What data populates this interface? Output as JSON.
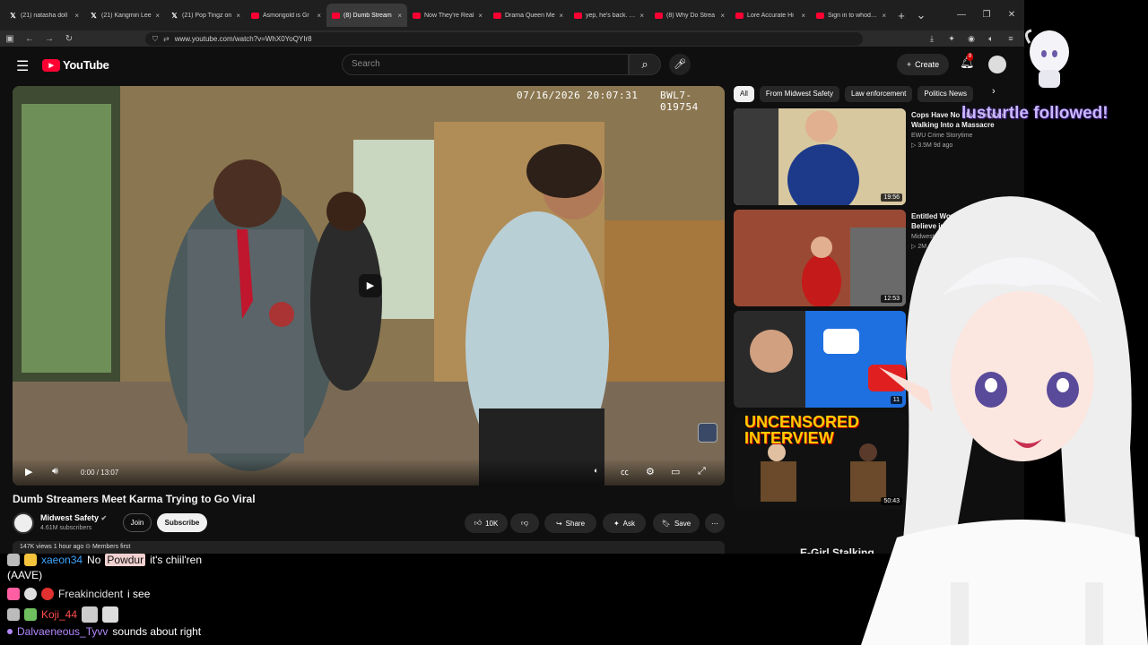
{
  "browser": {
    "tabs": [
      {
        "icon": "x",
        "title": "(21) natasha doll"
      },
      {
        "icon": "x",
        "title": "(21) Kangmin Lee"
      },
      {
        "icon": "x",
        "title": "(21) Pop Tingz on"
      },
      {
        "icon": "yt",
        "title": "Asmongold is Gr"
      },
      {
        "icon": "yt",
        "title": "(8) Dumb Stream"
      },
      {
        "icon": "yt",
        "title": "Now They're Real"
      },
      {
        "icon": "yt",
        "title": "Drama Queen Me"
      },
      {
        "icon": "yt",
        "title": "yep, he's back. - Y"
      },
      {
        "icon": "yt",
        "title": "(8) Why Do Strea"
      },
      {
        "icon": "yt",
        "title": "Lore Accurate Hi"
      },
      {
        "icon": "yt",
        "title": "Sign in to whodunchu"
      }
    ],
    "active_tab": 4,
    "new_tab": "+",
    "url": "www.youtube.com/watch?v=WhX0YoQYIr8"
  },
  "youtube": {
    "logo": "YouTube",
    "search_placeholder": "Search",
    "create_label": "Create",
    "notif_count": "8"
  },
  "video": {
    "osd_datetime": "07/16/2026 20:07:31",
    "osd_id": "BWL7-019754",
    "time": "0:00 / 13:07",
    "title": "Dumb Streamers Meet Karma Trying to Go Viral",
    "channel": "Midwest Safety",
    "subs": "4.61M subscribers",
    "join": "Join",
    "subscribe": "Subscribe",
    "likes": "10K",
    "share": "Share",
    "ask": "Ask",
    "save": "Save",
    "desc": "147K views  1 hour ago  ⊙ Members first"
  },
  "sidebar": {
    "chips": [
      "All",
      "From Midwest Safety",
      "Law enforcement",
      "Politics News"
    ],
    "recs": [
      {
        "title": "Cops Have No Idea They're Walking Into a Massacre",
        "channel": "EWU Crime Storytime",
        "meta": "▷ 3.5M  9d ago",
        "duration": "19:56"
      },
      {
        "title": "Entitled Woman Doesn't Believe in Private Pr",
        "channel": "Midwest Safety",
        "meta": "▷ 2M  6mo",
        "duration": "12:53"
      },
      {
        "title": "",
        "channel": "",
        "meta": "",
        "duration": "11"
      },
      {
        "title": "",
        "channel": "",
        "meta": "",
        "duration": "50:43"
      }
    ],
    "thumb4_text": "UNCENSORED INTERVIEW",
    "bottom_title": "E-Girl Stalking"
  },
  "overlay": {
    "follow_alert": "lusturtle followed!",
    "chat": [
      {
        "user": "xaeon34",
        "user_color": "#3ea6ff",
        "text_pre": "No",
        "highlight": "Powdur",
        "text_post": "it's chiil'ren"
      },
      {
        "user": "",
        "user_color": "#ffffff",
        "text_pre": "(AAVE)",
        "highlight": "",
        "text_post": ""
      },
      {
        "user": "Freakincident",
        "user_color": "#e0e0e0",
        "text_pre": "i see",
        "highlight": "",
        "text_post": ""
      },
      {
        "user": "Koji_44",
        "user_color": "#ff4d4d",
        "text_pre": "",
        "highlight": "",
        "text_post": ""
      },
      {
        "user": "Dalvaeneous_Tyvv",
        "user_color": "#b388ff",
        "text_pre": "sounds about right",
        "highlight": "",
        "text_post": ""
      }
    ]
  }
}
